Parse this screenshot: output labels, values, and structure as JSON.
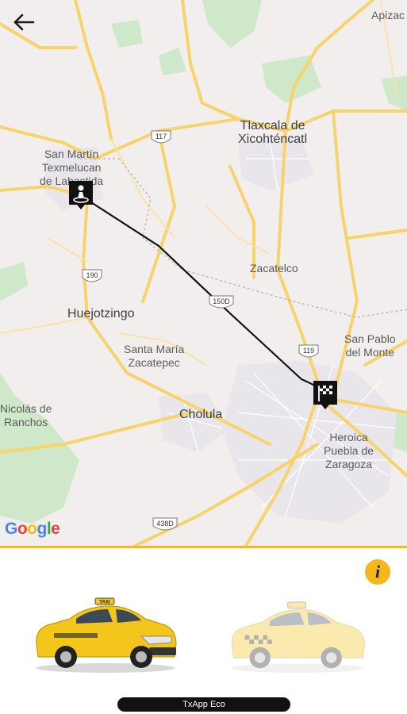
{
  "map": {
    "places": {
      "apizaco": "Apizac",
      "tlaxcala": "Tlaxcala de\nXicohténcatl",
      "san_martin": "San Martín\nTexmelucan\nde Labastida",
      "zacatelco": "Zacatelco",
      "huejotzingo": "Huejotzingo",
      "santa_maria": "Santa María\nZacatepec",
      "san_pablo": "San Pablo\ndel Monte",
      "nicolas": "Nicolás de\nRanchos",
      "cholula": "Cholula",
      "puebla": "Heroica\nPuebla de\nZaragoza"
    },
    "shields": [
      "117",
      "190",
      "150D",
      "119",
      "438D"
    ],
    "attribution": [
      "G",
      "o",
      "o",
      "g",
      "l",
      "e"
    ],
    "colors": {
      "road": "#f6d36b",
      "land": "#f2eeee",
      "park": "#c8e6c2",
      "route": "#111111"
    }
  },
  "icons": {
    "back": "arrow-left-icon",
    "origin": "origin-person-pin-icon",
    "destination": "checkered-flag-pin-icon",
    "info": "info-icon"
  },
  "bottom": {
    "info_label": "i",
    "service_name": "TxApp Eco",
    "car_sign": "TAXI"
  }
}
